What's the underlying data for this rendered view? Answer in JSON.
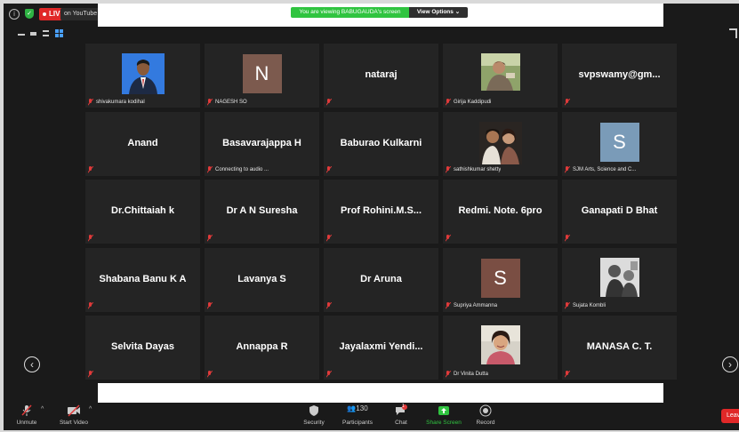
{
  "topbar": {
    "live_label": "LIVE",
    "youtube_label": "on YouTube",
    "viewing_banner": "You are viewing BABUGAUDA's screen",
    "view_options": "View Options"
  },
  "participants": [
    {
      "name": "",
      "footer": "shivakumara kodihal",
      "kind": "photo",
      "photo": "man-suit"
    },
    {
      "name": "",
      "footer": "NAGESH SO",
      "kind": "letter",
      "letter": "N",
      "color": "#7c5a4e"
    },
    {
      "name": "nataraj",
      "footer": "",
      "kind": "name"
    },
    {
      "name": "",
      "footer": "Girija Kaddipudi",
      "kind": "photo",
      "photo": "woman-outdoor"
    },
    {
      "name": "svpswamy@gm...",
      "footer": "",
      "kind": "name"
    },
    {
      "name": "Anand",
      "footer": "",
      "kind": "name"
    },
    {
      "name": "Basavarajappa H",
      "footer": "Connecting to audio ...",
      "kind": "name"
    },
    {
      "name": "Baburao Kulkarni",
      "footer": "",
      "kind": "name"
    },
    {
      "name": "",
      "footer": "sathishkumar shetty",
      "kind": "photo",
      "photo": "two-people"
    },
    {
      "name": "",
      "footer": "SJM Arts, Science and C...",
      "kind": "letter",
      "letter": "S",
      "color": "#7a9bb8"
    },
    {
      "name": "Dr.Chittaiah k",
      "footer": "",
      "kind": "name"
    },
    {
      "name": "Dr A N Suresha",
      "footer": "",
      "kind": "name"
    },
    {
      "name": "Prof  Rohini.M.S...",
      "footer": "",
      "kind": "name"
    },
    {
      "name": "Redmi. Note. 6pro",
      "footer": "",
      "kind": "name"
    },
    {
      "name": "Ganapati D Bhat",
      "footer": "",
      "kind": "name"
    },
    {
      "name": "Shabana Banu K A",
      "footer": "",
      "kind": "name"
    },
    {
      "name": "Lavanya S",
      "footer": "",
      "kind": "name"
    },
    {
      "name": "Dr Aruna",
      "footer": "",
      "kind": "name"
    },
    {
      "name": "",
      "footer": "Supriya Ammanna",
      "kind": "letter",
      "letter": "S",
      "color": "#7a4e43"
    },
    {
      "name": "",
      "footer": "Sujata Kombli",
      "kind": "photo",
      "photo": "bw-sketch"
    },
    {
      "name": "Selvita Dayas",
      "footer": "",
      "kind": "name"
    },
    {
      "name": "Annappa R",
      "footer": "",
      "kind": "name"
    },
    {
      "name": "Jayalaxmi  Yendi...",
      "footer": "",
      "kind": "name"
    },
    {
      "name": "",
      "footer": "Dr Vinita Dutta",
      "kind": "photo",
      "photo": "woman-smile"
    },
    {
      "name": "MANASA C. T.",
      "footer": "",
      "kind": "name"
    }
  ],
  "toolbar": {
    "unmute": "Unmute",
    "start_video": "Start Video",
    "security": "Security",
    "participants": "Participants",
    "participants_count": "130",
    "chat": "Chat",
    "chat_badge": "1",
    "share_screen": "Share Screen",
    "record": "Record",
    "leave": "Leave"
  }
}
